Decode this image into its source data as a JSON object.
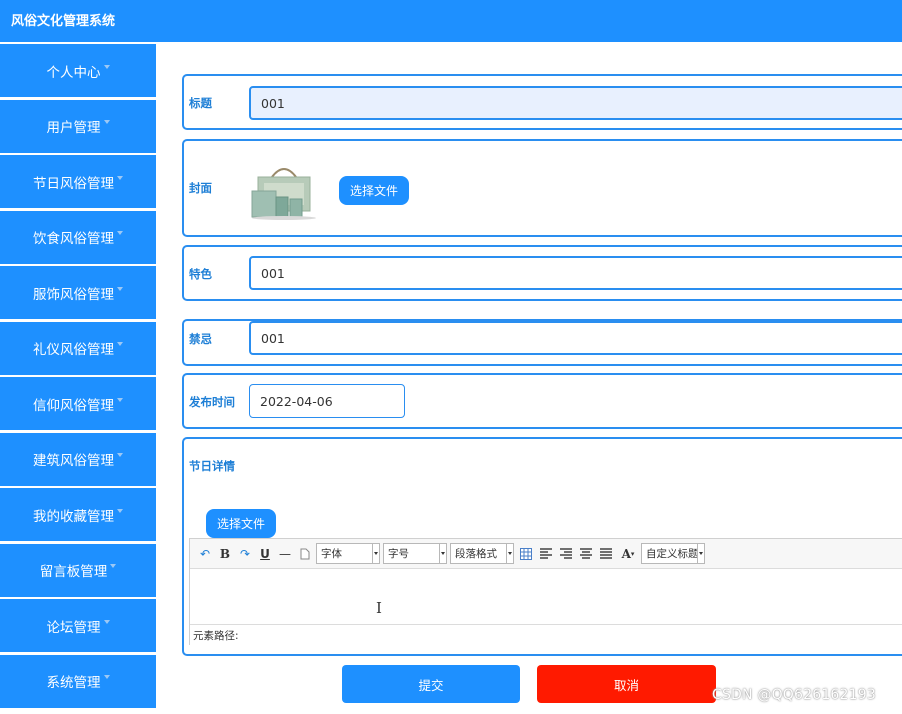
{
  "app": {
    "title": "风俗文化管理系统"
  },
  "sidebar": {
    "items": [
      {
        "label": "个人中心"
      },
      {
        "label": "用户管理"
      },
      {
        "label": "节日风俗管理"
      },
      {
        "label": "饮食风俗管理"
      },
      {
        "label": "服饰风俗管理"
      },
      {
        "label": "礼仪风俗管理"
      },
      {
        "label": "信仰风俗管理"
      },
      {
        "label": "建筑风俗管理"
      },
      {
        "label": "我的收藏管理"
      },
      {
        "label": "留言板管理"
      },
      {
        "label": "论坛管理"
      },
      {
        "label": "系统管理"
      }
    ]
  },
  "form": {
    "title": {
      "label": "标题",
      "value": "001"
    },
    "cover": {
      "label": "封面",
      "button": "选择文件",
      "image_icon": "tea-gift-box-image"
    },
    "feature": {
      "label": "特色",
      "value": "001"
    },
    "taboo": {
      "label": "禁忌",
      "value": "001"
    },
    "publish_time": {
      "label": "发布时间",
      "value": "2022-04-06"
    },
    "details": {
      "label": "节日详情",
      "button": "选择文件",
      "toolbar": {
        "font": "字体",
        "size": "字号",
        "paragraph": "段落格式",
        "custom_title": "自定义标题"
      },
      "path_label": "元素路径:"
    }
  },
  "actions": {
    "submit": "提交",
    "cancel": "取消"
  },
  "watermark": "CSDN @QQ626162193",
  "colors": {
    "primary": "#1e90ff",
    "danger": "#ff1a00",
    "input_highlight": "#e8f0fe"
  }
}
